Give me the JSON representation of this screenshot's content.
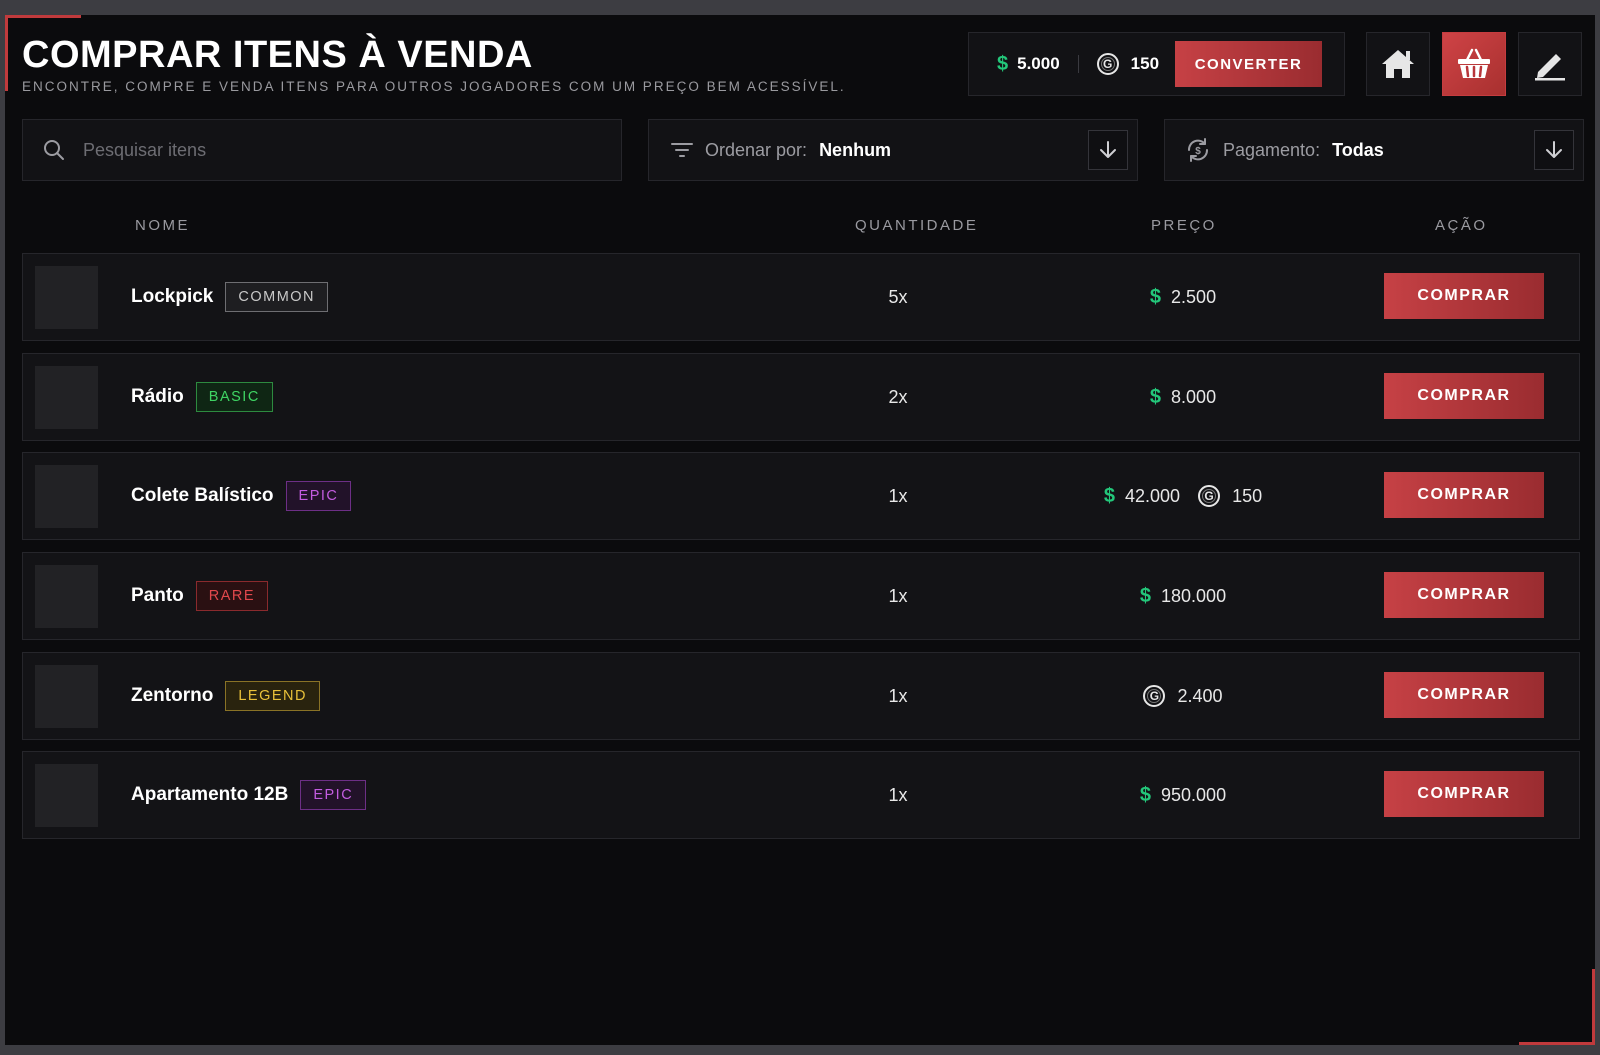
{
  "header": {
    "title": "COMPRAR ITENS À VENDA",
    "subtitle": "ENCONTRE, COMPRE E VENDA ITENS PARA OUTROS JOGADORES COM UM PREÇO BEM ACESSÍVEL."
  },
  "wallet": {
    "money": "5.000",
    "coins": "150",
    "convert_label": "CONVERTER",
    "money_color": "#23c77a"
  },
  "nav": {
    "icons": [
      "home-icon",
      "basket-icon",
      "pencil-icon"
    ],
    "active": "basket-icon",
    "accent": "#c64145"
  },
  "search": {
    "placeholder": "Pesquisar itens",
    "value": ""
  },
  "sort": {
    "label": "Ordenar por:",
    "value": "Nenhum"
  },
  "payment": {
    "label": "Pagamento:",
    "value": "Todas"
  },
  "columns": {
    "name": "NOME",
    "quantity": "QUANTIDADE",
    "price": "PREÇO",
    "action": "AÇÃO"
  },
  "items": [
    {
      "name": "Lockpick",
      "rarity": "COMMON",
      "rarity_color": "#c9c9c9",
      "rarity_bg": "#1e1e21",
      "rarity_border": "#6e6e72",
      "quantity": "5x",
      "money": "2.500",
      "coins": null,
      "action": "COMPRAR"
    },
    {
      "name": "Rádio",
      "rarity": "BASIC",
      "rarity_color": "#3fd463",
      "rarity_bg": "#0f2614",
      "rarity_border": "#2d8a3f",
      "quantity": "2x",
      "money": "8.000",
      "coins": null,
      "action": "COMPRAR"
    },
    {
      "name": "Colete Balístico",
      "rarity": "EPIC",
      "rarity_color": "#c35ce0",
      "rarity_bg": "#221229",
      "rarity_border": "#6d2f86",
      "quantity": "1x",
      "money": "42.000",
      "coins": "150",
      "action": "COMPRAR"
    },
    {
      "name": "Panto",
      "rarity": "RARE",
      "rarity_color": "#e2484c",
      "rarity_bg": "#2a1012",
      "rarity_border": "#8a2a2d",
      "quantity": "1x",
      "money": "180.000",
      "coins": null,
      "action": "COMPRAR"
    },
    {
      "name": "Zentorno",
      "rarity": "LEGEND",
      "rarity_color": "#e8c13a",
      "rarity_bg": "#29230e",
      "rarity_border": "#8a7326",
      "quantity": "1x",
      "money": null,
      "coins": "2.400",
      "action": "COMPRAR"
    },
    {
      "name": "Apartamento 12B",
      "rarity": "EPIC",
      "rarity_color": "#c35ce0",
      "rarity_bg": "#221229",
      "rarity_border": "#6d2f86",
      "quantity": "1x",
      "money": "950.000",
      "coins": null,
      "action": "COMPRAR"
    }
  ]
}
